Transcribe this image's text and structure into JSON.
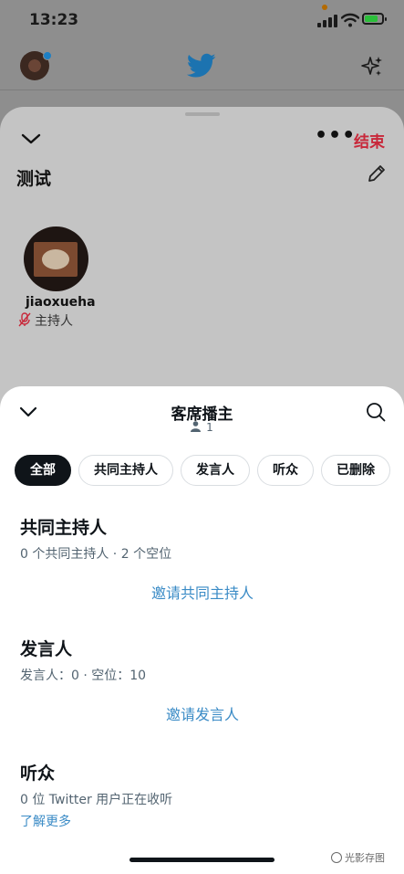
{
  "status_bar": {
    "time": "13:23"
  },
  "space": {
    "end_label": "结束",
    "title": "测试",
    "host": {
      "name": "jiaoxueha",
      "role": "主持人"
    }
  },
  "sheet": {
    "title": "客席播主",
    "listener_count": "1",
    "tabs": [
      {
        "label": "全部",
        "active": true
      },
      {
        "label": "共同主持人",
        "active": false
      },
      {
        "label": "发言人",
        "active": false
      },
      {
        "label": "听众",
        "active": false
      },
      {
        "label": "已删除",
        "active": false
      }
    ],
    "cohosts": {
      "heading": "共同主持人",
      "summary": "0 个共同主持人 · 2 个空位",
      "invite": "邀请共同主持人"
    },
    "speakers": {
      "heading": "发言人",
      "summary": "发言人：0 · 空位：10",
      "invite": "邀请发言人"
    },
    "listeners": {
      "heading": "听众",
      "summary": "0 位 Twitter 用户正在收听",
      "learn_more": "了解更多"
    }
  },
  "watermark": "光影存图",
  "colors": {
    "end": "#c8283a",
    "link": "#3a8bc6",
    "active_tab": "#0f1419",
    "battery": "#2bbf3a"
  },
  "battery_level": 0.8
}
